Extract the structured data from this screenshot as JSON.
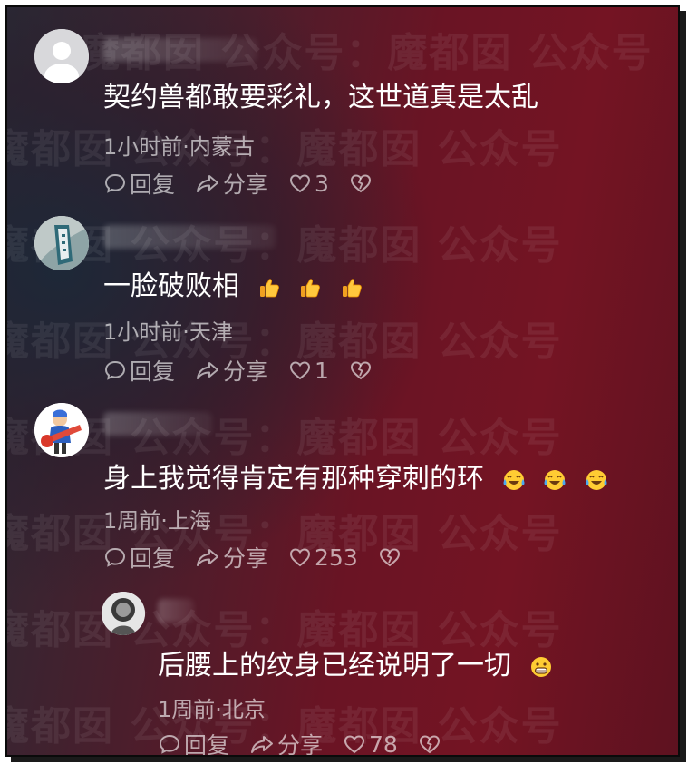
{
  "watermark": "魔都囡 公众号：魔都囡",
  "comments": [
    {
      "text": "契约兽都敢要彩礼，这世道真是太乱",
      "meta": "1小时前·内蒙古",
      "reply_label": "回复",
      "share_label": "分享",
      "likes": "3"
    },
    {
      "text": "一脸破败相",
      "meta": "1小时前·天津",
      "reply_label": "回复",
      "share_label": "分享",
      "likes": "1",
      "emoji": [
        "thumbs-up",
        "thumbs-up",
        "thumbs-up"
      ]
    },
    {
      "text": "身上我觉得肯定有那种穿刺的环",
      "meta": "1周前·上海",
      "reply_label": "回复",
      "share_label": "分享",
      "likes": "253",
      "emoji": [
        "tears-of-joy",
        "tears-of-joy",
        "tears-of-joy"
      ]
    },
    {
      "text": "后腰上的纹身已经说明了一切",
      "meta": "1周前·北京",
      "reply_label": "回复",
      "share_label": "分享",
      "likes": "78",
      "emoji": [
        "grinning-face"
      ]
    }
  ],
  "colors": {
    "text": "#ffffff",
    "meta": "#a89a9e",
    "background_accent": "#741423"
  }
}
